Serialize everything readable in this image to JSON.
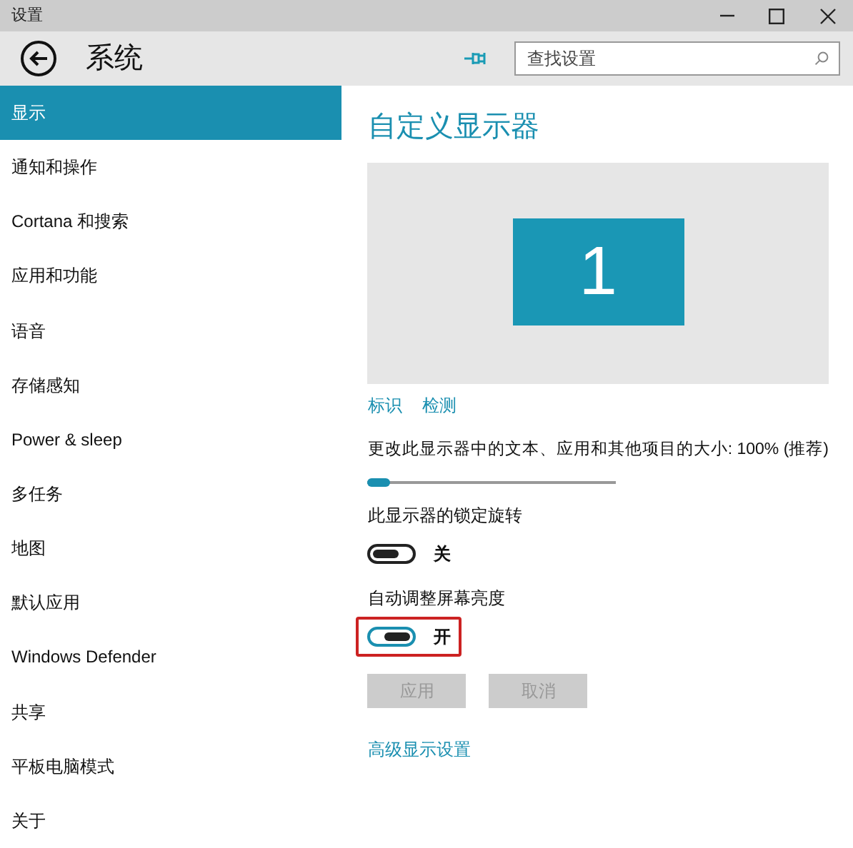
{
  "window": {
    "title": "设置"
  },
  "header": {
    "title": "系统",
    "search": {
      "placeholder": "查找设置"
    }
  },
  "sidebar": {
    "items": [
      {
        "label": "显示",
        "selected": true
      },
      {
        "label": "通知和操作",
        "selected": false
      },
      {
        "label": "Cortana 和搜索",
        "selected": false
      },
      {
        "label": "应用和功能",
        "selected": false
      },
      {
        "label": "语音",
        "selected": false
      },
      {
        "label": "存储感知",
        "selected": false
      },
      {
        "label": "Power & sleep",
        "selected": false
      },
      {
        "label": "多任务",
        "selected": false
      },
      {
        "label": "地图",
        "selected": false
      },
      {
        "label": "默认应用",
        "selected": false
      },
      {
        "label": "Windows Defender",
        "selected": false
      },
      {
        "label": "共享",
        "selected": false
      },
      {
        "label": "平板电脑模式",
        "selected": false
      },
      {
        "label": "关于",
        "selected": false
      }
    ]
  },
  "main": {
    "title": "自定义显示器",
    "monitor": "1",
    "links": [
      "标识",
      "检测"
    ],
    "scale": {
      "label": "更改此显示器中的文本、应用和其他项目的大小: 100% (推荐)",
      "level": 0.0
    },
    "toggles": [
      {
        "label": "此显示器的锁定旋转",
        "state": "关",
        "on": false,
        "highlighted": false
      },
      {
        "label": "自动调整屏幕亮度",
        "state": "开",
        "on": true,
        "highlighted": true
      }
    ],
    "buttons": [
      {
        "label": "应用",
        "disabled": true
      },
      {
        "label": "取消",
        "disabled": true
      }
    ],
    "advanced_link": "高级显示设置"
  }
}
